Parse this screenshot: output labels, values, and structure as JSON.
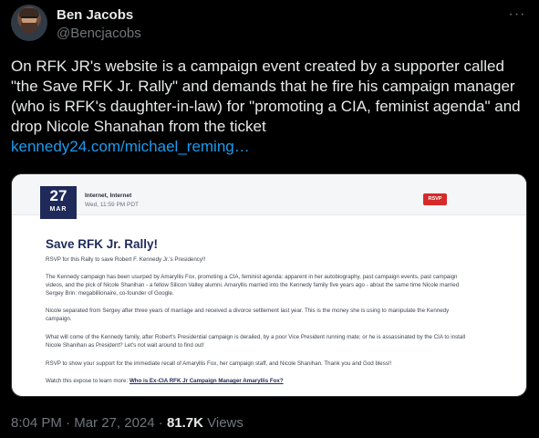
{
  "author": {
    "display_name": "Ben Jacobs",
    "handle": "@Bencjacobs"
  },
  "tweet": {
    "text": "On RFK JR's website is a campaign event created by a supporter called \"the Save RFK Jr. Rally\" and demands that he fire his campaign manager (who is RFK's daughter-in-law) for \"promoting a CIA, feminist agenda\" and drop Nicole Shanahan from the ticket",
    "link": "kennedy24.com/michael_reming…"
  },
  "card": {
    "date_day": "27",
    "date_month": "MAR",
    "location": "Internet, Internet",
    "time": "Wed, 11:59 PM PDT",
    "rsvp_label": "RSVP",
    "title": "Save RFK Jr. Rally!",
    "paragraphs": [
      "RSVP for this Rally to save Robert F. Kennedy Jr.'s Presidency!!",
      "The Kennedy campaign has been usurped by Amaryllis Fox, promoting a CIA, feminist agenda: apparent in her autobiography, past campaign events, past campaign videos, and the pick of Nicole Shanihan - a fellow Silicon Valley alumni.  Amaryllis married into the Kennedy family five years ago - about the same time Nicole married Sergey Brin: megabillionaire, co-founder of Google.",
      "Nicole separated from Sergey after three years of marriage and received a divorce settlement last year.  This is the money she is using to manipulate the Kennedy campaign.",
      "What will come of the Kennedy family, after Robert's Presidential campaign is derailed, by a poor Vice President running mate; or he is assassinated by the CIA to install Nicole Shanihan as President?  Let's not wait around to find out!",
      "RSVP to show your support for the immediate recall of Amaryllis Fox, her campaign staff, and Nicole Shanihan.  Thank you and God bless!!"
    ],
    "watch_prefix": "Watch this expose to learn more: ",
    "watch_link": "Who is Ex-CIA RFK Jr Campaign Manager Amaryllis Fox?"
  },
  "footer": {
    "time": "8:04 PM",
    "separator1": " · ",
    "date": "Mar 27, 2024",
    "separator2": " · ",
    "views_count": "81.7K",
    "views_label": " Views"
  },
  "icons": {
    "more": "more-horizontal-icon"
  },
  "colors": {
    "background": "#000000",
    "text": "#e7e9ea",
    "muted": "#71767b",
    "link": "#1d9bf0",
    "event_navy": "#1f2a5a",
    "rsvp_red": "#d62a2a"
  }
}
